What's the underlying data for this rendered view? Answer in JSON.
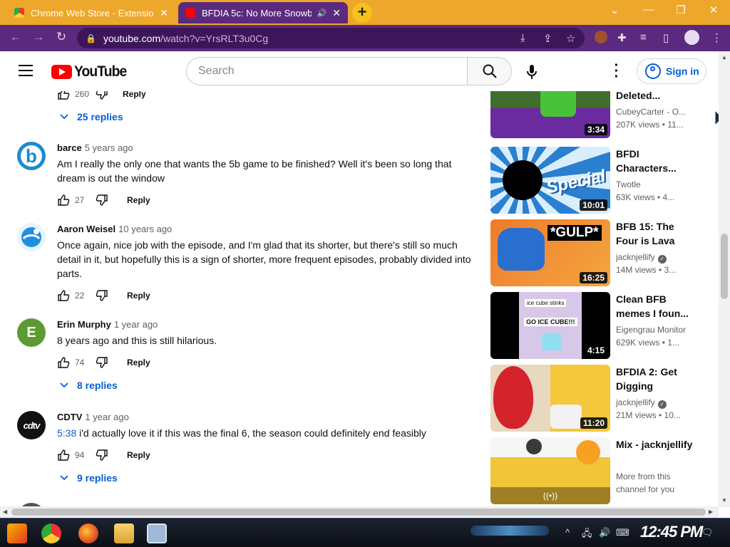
{
  "browser": {
    "tabs": [
      {
        "title": "Chrome Web Store - Extensions",
        "active": false
      },
      {
        "title": "BFDIA 5c: No More Snowball Fights",
        "active": true
      }
    ],
    "new_tab_label": "+",
    "url_host": "youtube.com",
    "url_path": "/watch?v=YrsRLT3u0Cg",
    "theme_color": "#5b2a7e",
    "tabstrip_color": "#eda72a"
  },
  "youtube": {
    "logo_text": "YouTube",
    "search_placeholder": "Search",
    "signin_label": "Sign in"
  },
  "comments": [
    {
      "partial": true,
      "likes": "260",
      "reply_label": "Reply",
      "replies": "25 replies"
    },
    {
      "author": "barce",
      "time": "5 years ago",
      "avatar_letter": "b",
      "avatar_color": "#1a8ccf",
      "text": "Am I really the only one that wants the 5b game to be finished? Well it's been so long that dream is out the window",
      "likes": "27",
      "reply_label": "Reply"
    },
    {
      "author": "Aaron Weisel",
      "time": "10 years ago",
      "avatar_letter": "",
      "avatar_color": "#1e90e0",
      "text": "Once again, nice job with the episode, and I'm glad that its shorter, but there's still so much detail in it, but hopefully this is a sign of shorter, more frequent episodes, probably divided into parts.",
      "likes": "22",
      "reply_label": "Reply"
    },
    {
      "author": "Erin Murphy",
      "time": "1 year ago",
      "avatar_letter": "E",
      "avatar_color": "#5b9b32",
      "text": "8 years ago and this is still hilarious.",
      "likes": "74",
      "reply_label": "Reply",
      "replies": "8 replies"
    },
    {
      "author": "CDTV",
      "time": "1 year ago",
      "avatar_letter": "cdtv",
      "avatar_color": "#111111",
      "timestamp": "5:38",
      "text": " i'd actually love it if this was the final 6, the season could definitely end feasibly",
      "likes": "94",
      "reply_label": "Reply",
      "replies": "9 replies"
    }
  ],
  "sidebar": [
    {
      "title": "Deleted...",
      "channel": "CubeyCarter - O...",
      "stats": "207K views  •  11...",
      "duration": "3:34",
      "verified": false
    },
    {
      "title": "BFDI Characters...",
      "channel": "Twotle",
      "stats": "63K views  •  4...",
      "duration": "10:01",
      "verified": false,
      "thumb_text": "Special"
    },
    {
      "title": "BFB 15: The Four is Lava",
      "channel": "jacknjellify",
      "stats": "14M views  •  3...",
      "duration": "16:25",
      "verified": true,
      "thumb_text": "*GULP*"
    },
    {
      "title": "Clean BFB memes I foun...",
      "channel": "Eigengrau Monitor",
      "stats": "629K views  •  1...",
      "duration": "4:15",
      "verified": false,
      "thumb_text": "ice cube stinks",
      "thumb_text2": "GO ICE CUBE!!!"
    },
    {
      "title": "BFDIA 2: Get Digging",
      "channel": "jacknjellify",
      "stats": "21M views  •  10...",
      "duration": "11:20",
      "verified": true
    },
    {
      "title": "Mix - jacknjellify",
      "channel": "More from this channel for you",
      "stats": "",
      "duration": "",
      "verified": false,
      "mix": true
    }
  ],
  "taskbar": {
    "clock": "12:45 PM"
  }
}
